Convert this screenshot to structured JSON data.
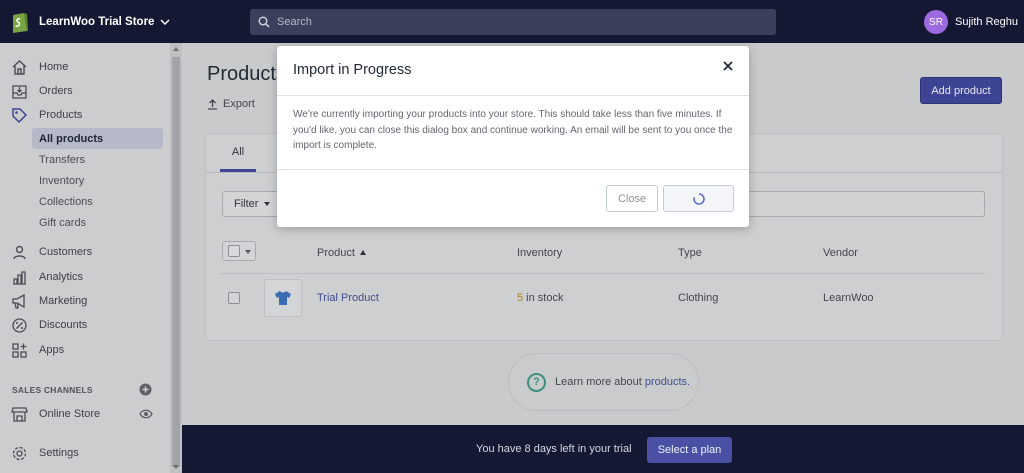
{
  "topbar": {
    "store_name": "LearnWoo Trial Store",
    "search_placeholder": "Search",
    "user_initials": "SR",
    "user_name": "Sujith Reghu"
  },
  "sidebar": {
    "items": [
      {
        "label": "Home",
        "icon": "home-icon"
      },
      {
        "label": "Orders",
        "icon": "orders-icon"
      },
      {
        "label": "Products",
        "icon": "tag-icon"
      },
      {
        "label": "Customers",
        "icon": "customers-icon"
      },
      {
        "label": "Analytics",
        "icon": "analytics-icon"
      },
      {
        "label": "Marketing",
        "icon": "megaphone-icon"
      },
      {
        "label": "Discounts",
        "icon": "discount-icon"
      },
      {
        "label": "Apps",
        "icon": "apps-icon"
      }
    ],
    "product_subitems": [
      "All products",
      "Transfers",
      "Inventory",
      "Collections",
      "Gift cards"
    ],
    "sales_channels_title": "SALES CHANNELS",
    "online_store": "Online Store",
    "settings": "Settings"
  },
  "main": {
    "title": "Products",
    "export_label": "Export",
    "add_product_label": "Add product",
    "tab_all": "All",
    "filter_label": "Filter",
    "columns": {
      "product": "Product",
      "inventory": "Inventory",
      "type": "Type",
      "vendor": "Vendor"
    },
    "rows": [
      {
        "product": "Trial Product",
        "stock_count": "5",
        "stock_suffix": " in stock",
        "type": "Clothing",
        "vendor": "LearnWoo"
      }
    ],
    "learn_more_prefix": "Learn more about",
    "learn_more_link": "products."
  },
  "trial": {
    "text": "You have 8 days left in your trial",
    "button": "Select a plan"
  },
  "modal": {
    "title": "Import in Progress",
    "body": "We're currently importing your products into your store. This should take less than five minutes. If you'd like, you can close this dialog box and continue working. An email will be sent to you once the import is complete.",
    "close_label": "Close"
  },
  "colors": {
    "topbar": "#141833",
    "accent": "#3e4494",
    "link": "#3d4d8f",
    "stock_highlight": "#b57c1f"
  }
}
